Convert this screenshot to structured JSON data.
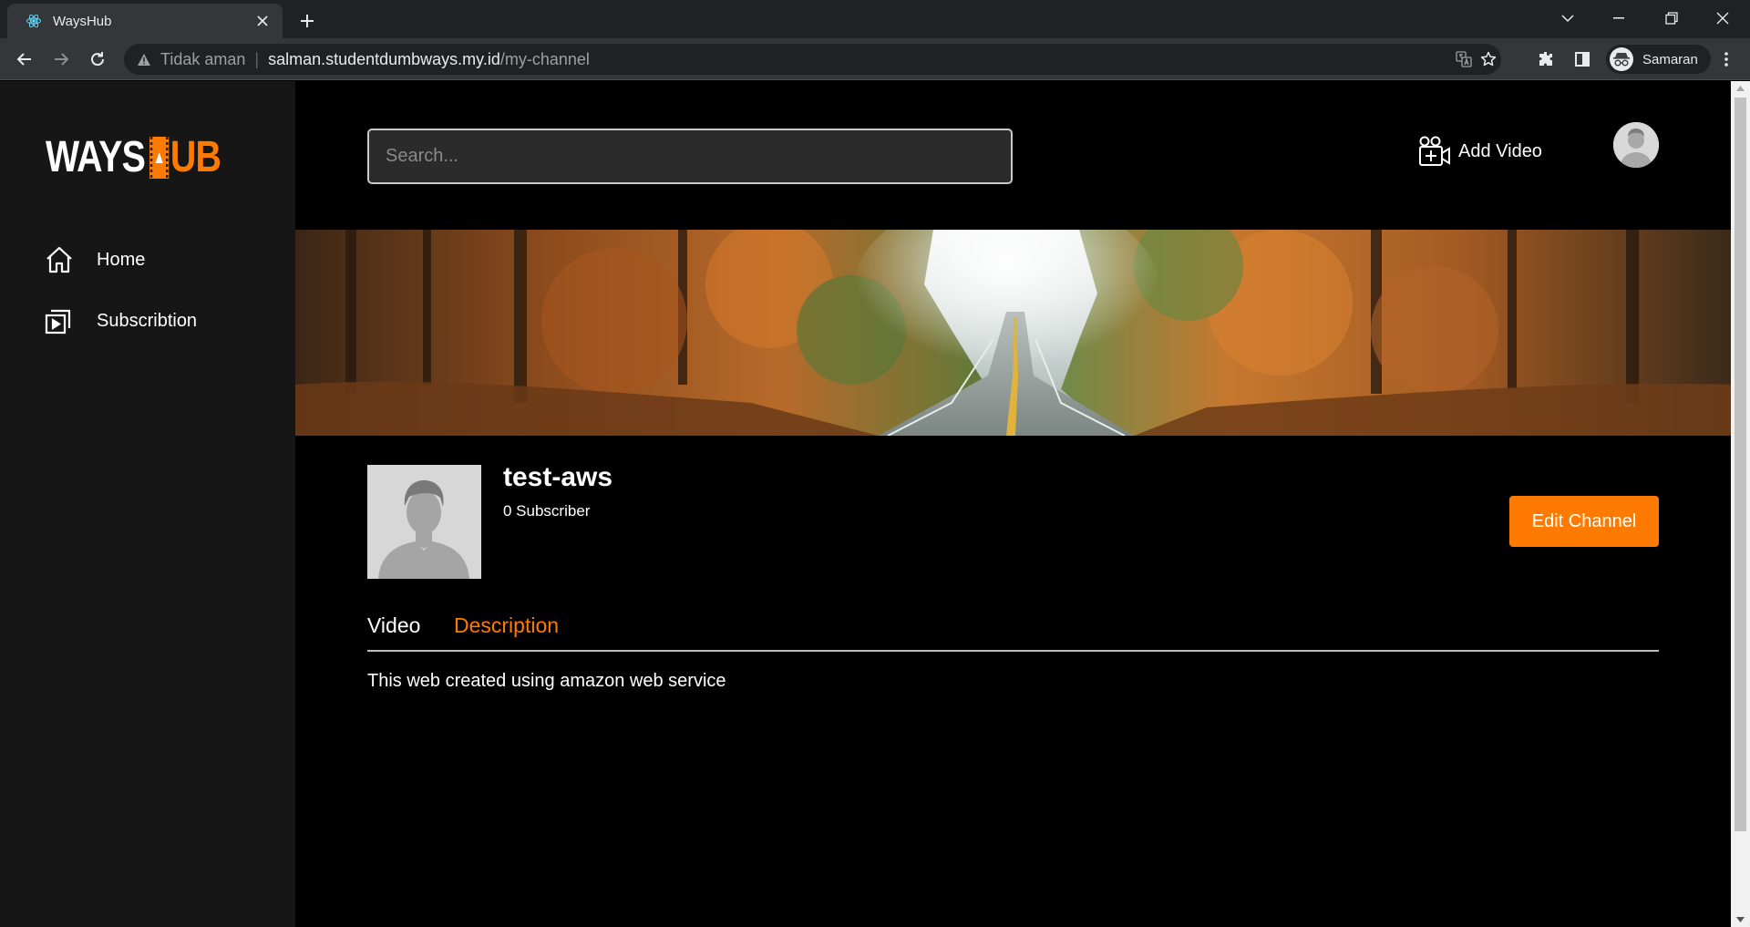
{
  "browser": {
    "tab_title": "WaysHub",
    "omnibox": {
      "security_label": "Tidak aman",
      "separator": "|",
      "host": "salman.studentdumbways.my.id",
      "path": "/my-channel"
    },
    "profile_label": "Samaran"
  },
  "sidebar": {
    "logo_ways": "WAYS",
    "logo_ub": "UB",
    "items": [
      {
        "label": "Home",
        "icon": "home-icon"
      },
      {
        "label": "Subscribtion",
        "icon": "subscription-icon"
      }
    ]
  },
  "header": {
    "search_placeholder": "Search...",
    "add_video_label": "Add Video"
  },
  "channel": {
    "name": "test-aws",
    "subscribers": "0 Subscriber",
    "edit_label": "Edit Channel",
    "tabs": [
      {
        "label": "Video",
        "active": false
      },
      {
        "label": "Description",
        "active": true
      }
    ],
    "description": "This web created using amazon web service"
  },
  "colors": {
    "accent": "#ff7a00",
    "sidebar_bg": "#161616",
    "page_bg": "#000000"
  }
}
